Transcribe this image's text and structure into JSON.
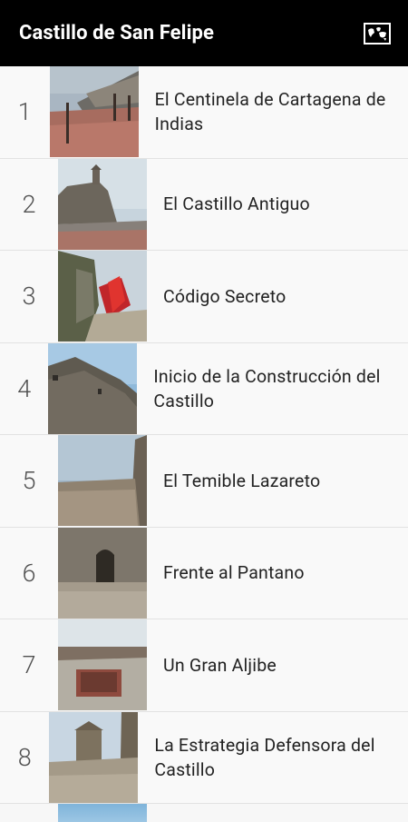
{
  "app": {
    "title": "Castillo de San Felipe",
    "map_icon": "world-map-icon"
  },
  "items": [
    {
      "number": "1",
      "title": "El Centinela de Cartagena de Indias"
    },
    {
      "number": "2",
      "title": "El Castillo Antiguo"
    },
    {
      "number": "3",
      "title": "Código Secreto"
    },
    {
      "number": "4",
      "title": "Inicio de la Construcción del Castillo"
    },
    {
      "number": "5",
      "title": "El Temible Lazareto"
    },
    {
      "number": "6",
      "title": "Frente al Pantano"
    },
    {
      "number": "7",
      "title": "Un Gran Aljibe"
    },
    {
      "number": "8",
      "title": "La Estrategia Defensora del Castillo"
    }
  ],
  "colors": {
    "appbar_bg": "#000000",
    "appbar_text": "#ffffff",
    "list_bg": "#f9f9f9",
    "divider": "#e2e2e2"
  }
}
